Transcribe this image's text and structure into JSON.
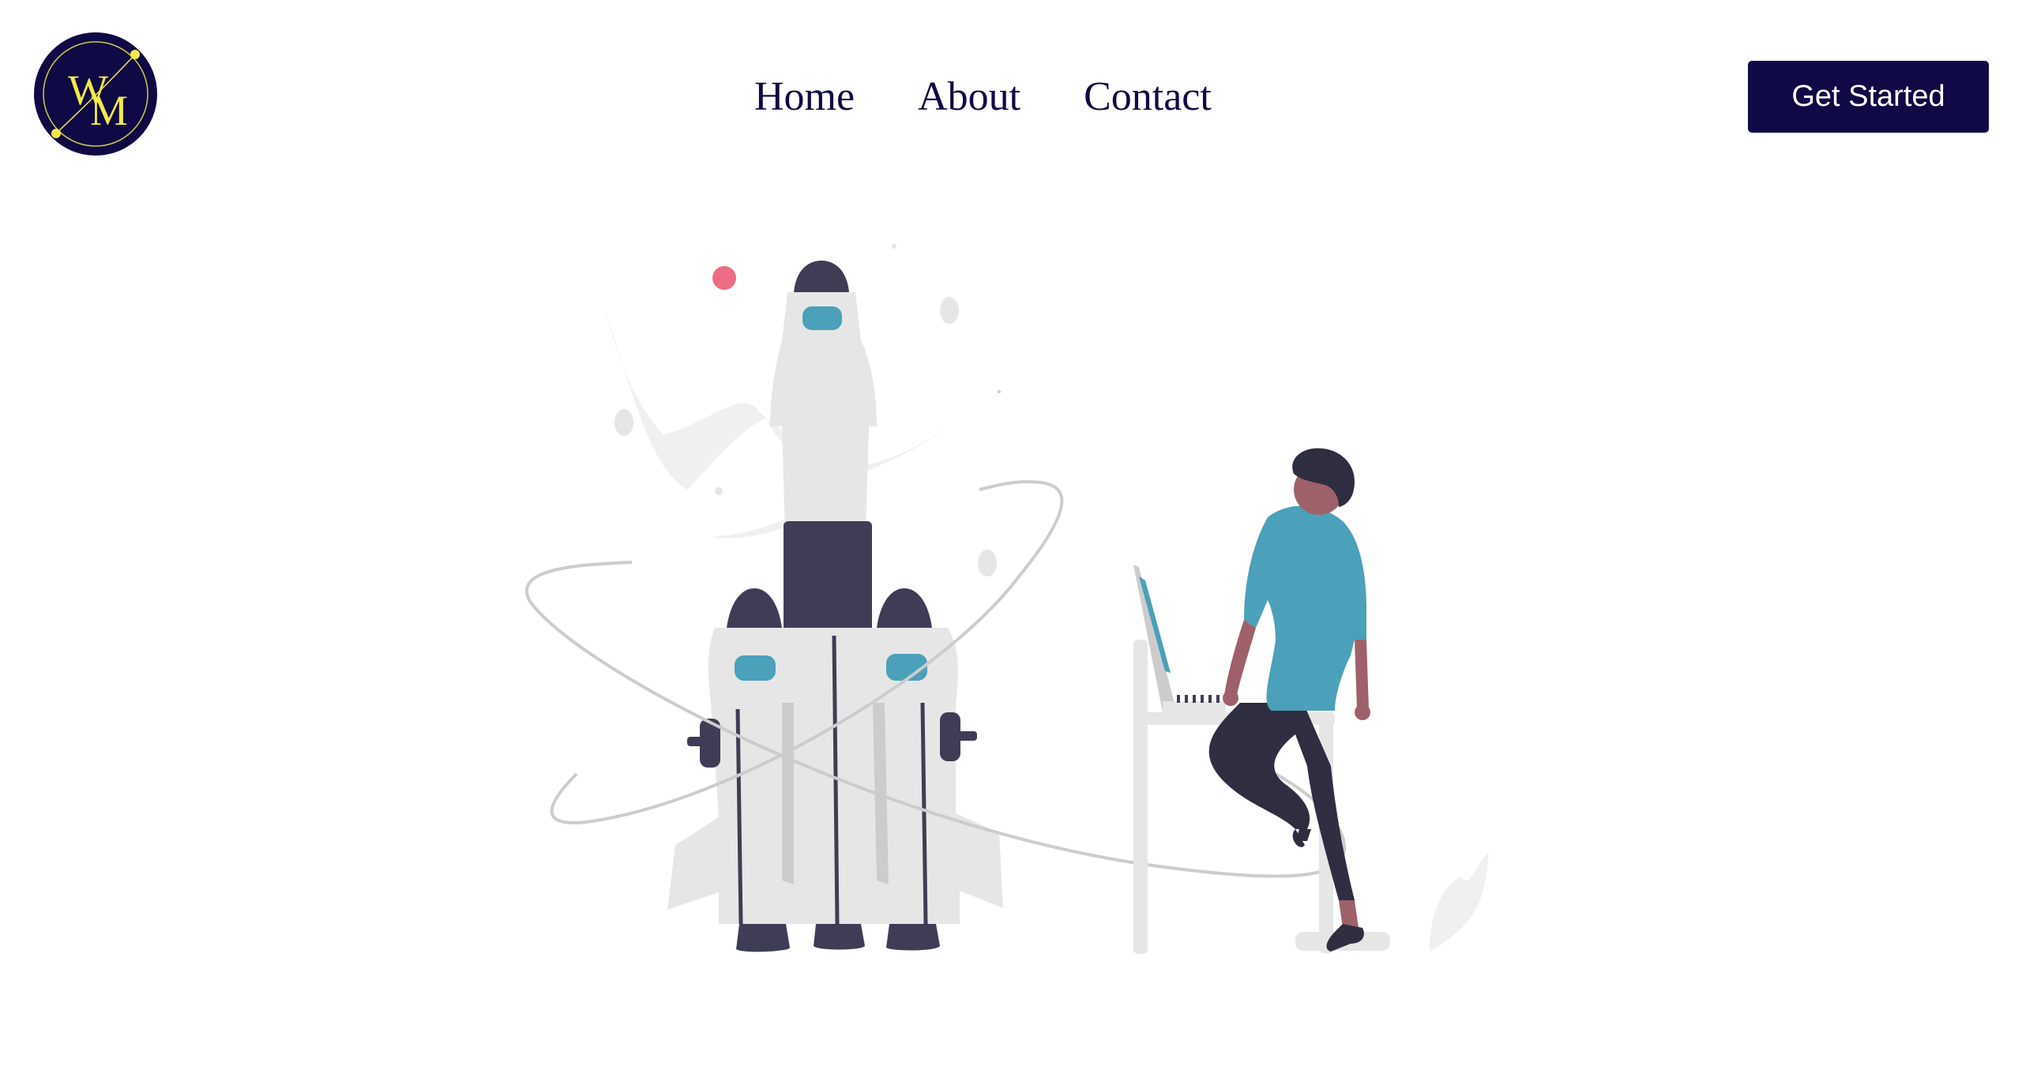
{
  "header": {
    "logo": {
      "letters": "WM",
      "icon": "wm-monogram-logo",
      "colors": {
        "circle": "#0f0a45",
        "letters": "#f2ea4a"
      }
    },
    "nav": [
      {
        "label": "Home"
      },
      {
        "label": "About"
      },
      {
        "label": "Contact"
      }
    ],
    "cta_label": "Get Started"
  },
  "hero": {
    "illustration": "rocket-launch-person-at-laptop",
    "colors": {
      "dark": "#3f3d56",
      "accent": "#4ba0ba",
      "light_gray": "#e6e6e6",
      "orbit": "#cccccc",
      "pink": "#ec6c84",
      "skin": "#9e616a",
      "pants": "#2f2e41"
    }
  }
}
